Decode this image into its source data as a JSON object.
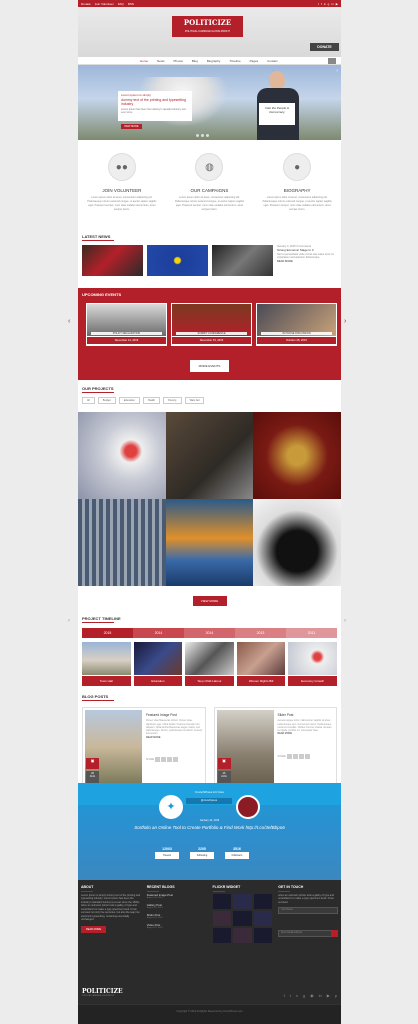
{
  "topbar": {
    "links": [
      "Donate",
      "Join Volunteer",
      "FAQ",
      "RSS"
    ],
    "social_icons": [
      "twitter-icon",
      "facebook-icon",
      "flickr-icon",
      "googleplus-icon",
      "linkedin-icon",
      "youtube-icon"
    ]
  },
  "header": {
    "logo": "POLITICIZE",
    "tagline": "POLITICAL CAMPAIGN & NON-PROFIT",
    "donate_label": "DONATE"
  },
  "nav": {
    "items": [
      "Home",
      "News",
      "Photos",
      "Blog",
      "Biography",
      "Timeline",
      "Pages",
      "Contact"
    ]
  },
  "hero": {
    "line1": "Lorem Ipsum is simply",
    "line2": "dummy text of the printing and typesetting industry",
    "line3": "Lorem Ipsum has been the industry's standard dummy text ever since",
    "button": "VIEW MORE",
    "sign": "Vote the People & Democracy"
  },
  "features": [
    {
      "title": "JOIN VOLUNTEER",
      "icon": "users-icon",
      "text": "Lorem ipsum dolor sit amet, consectetur adipiscing elit. Pellentesque rutrum euismod congue, et auctor sapien sagittis eget. Praesent semper, nunc vitae sodales elementum, amet semper lorem."
    },
    {
      "title": "OUR CAMPAIGNS",
      "icon": "globe-icon",
      "text": "Lorem ipsum dolor sit amet, consectetur adipiscing elit. Pellentesque rutrum euismod congue, et auctor sapien sagittis eget. Praesent semper, nunc vitae sodales elementum, amet semper lorem."
    },
    {
      "title": "BIOGRAPHY",
      "icon": "person-icon",
      "text": "Lorem ipsum dolor sit amet, consectetur adipiscing elit. Pellentesque rutrum euismod congue, et auctor sapien sagittis eget. Praesent semper, nunc vitae sodales elementum, amet semper lorem."
    }
  ],
  "news": {
    "title": "LATEST NEWS",
    "meta": "January 4, 2015   2 Comments",
    "headline": "Strong Econonic Stage In 3",
    "excerpt": "Sed ut perspiciatis unde omnis iste natus error sit voluptatem accusantium doloremque",
    "read": "READ MORE"
  },
  "events": {
    "title": "UPCOMING EVENTS",
    "items": [
      {
        "caption": "POLICY DECLARATION",
        "date": "November 14, 2015"
      },
      {
        "caption": "SUMMIT CONFERENCE",
        "date": "November 15, 2015"
      },
      {
        "caption": "IN HOUSE DISCUSSION",
        "date": "October 28, 2015"
      }
    ],
    "more": "MORE EVENTS"
  },
  "projects": {
    "title": "OUR PROJECTS",
    "filters": [
      "All",
      "Budget",
      "Education",
      "Health",
      "Poverty",
      "Wars Aid"
    ],
    "button": "VIEW MORE"
  },
  "timeline": {
    "title": "PROJECT TIMELINE",
    "years": [
      "2015",
      "2014",
      "2014",
      "2013",
      "2011"
    ],
    "items": [
      "Town Hall",
      "Education",
      "Stop Child Labour",
      "Women Rights Bill",
      "Economy Growth"
    ]
  },
  "blog": {
    "title": "BLOG POSTS",
    "posts": [
      {
        "day": "28",
        "month": "AUG",
        "title": "Featured Image Post",
        "text": "Donec vitae Maecenas dictum. Donec vitae, dignissim eget. Nulla facilisi. Vivamus interdum dui aliquam. Nulla lacinia Maecenas augue mattis, sed pellentesque. Donec, pellentesque hendrerit. Aenean fermentum.",
        "read": "READ MORE",
        "share": "SHARE"
      },
      {
        "day": "26",
        "month": "AUG",
        "title": "Slider Post",
        "text": "Aenean augue tortor, ullamcorper sagittis sit amet, pellentesque sem. Fermentum lacus. Pellentesque euismod convallis. Nullam rhoncus massa. Aenean leo ligula, porttitor eu, consequat vitae.",
        "read": "READ MORE",
        "share": "SHARE"
      }
    ]
  },
  "twitter": {
    "name": "CrunchPress Art Core",
    "handle": "@crunchpress",
    "date": "January 14, 2015",
    "tweet": "Sortfolio an Online Tool to Create Portfolio & Find Work http://t.co/3efBbpo6",
    "stats": [
      {
        "n": "12003",
        "l": "Tweets"
      },
      {
        "n": "2205",
        "l": "Following"
      },
      {
        "n": "3516",
        "l": "Followers"
      }
    ]
  },
  "footer": {
    "about_title": "ABOUT",
    "about_text": "Lorem Ipsum is simply dummy text of the printing and typesetting industry. Lorem Ipsum has been the industry's standard dummy text ever since the 1500s, when an unknown printer took a galley of type and scrambled it to make a type specimen book. It has survived not only five centuries, but also the leap into electronic typesetting, remaining essentially unchanged.",
    "read": "READ MORE",
    "blogs_title": "RECENT BLOGS",
    "blogs": [
      {
        "t": "Featured Image Post",
        "d": "August 28, 2014"
      },
      {
        "t": "Gallery Post",
        "d": "August 28, 2014"
      },
      {
        "t": "Slider Post",
        "d": "August 26, 2014"
      },
      {
        "t": "Video Post",
        "d": "August 25, 2014"
      }
    ],
    "flickr_title": "FLICKR WIDGET",
    "touch_title": "GET IN TOUCH",
    "touch_text": "when an unknown printer took a galley of type and scrambled it to make a type specimen book. it has survived.",
    "name_ph": "Your Name",
    "email_ph": "Enter Email Address",
    "logo": "POLITICIZE",
    "tagline": "POLITICAL CAMPAIGN & NON-PROFIT",
    "copyright": "Copyright © 2014 All Rights Reserved by CrunchPress.com"
  },
  "colors": {
    "accent": "#b3202a",
    "twitter": "#1b9ad6",
    "footer": "#2b2b2b"
  }
}
